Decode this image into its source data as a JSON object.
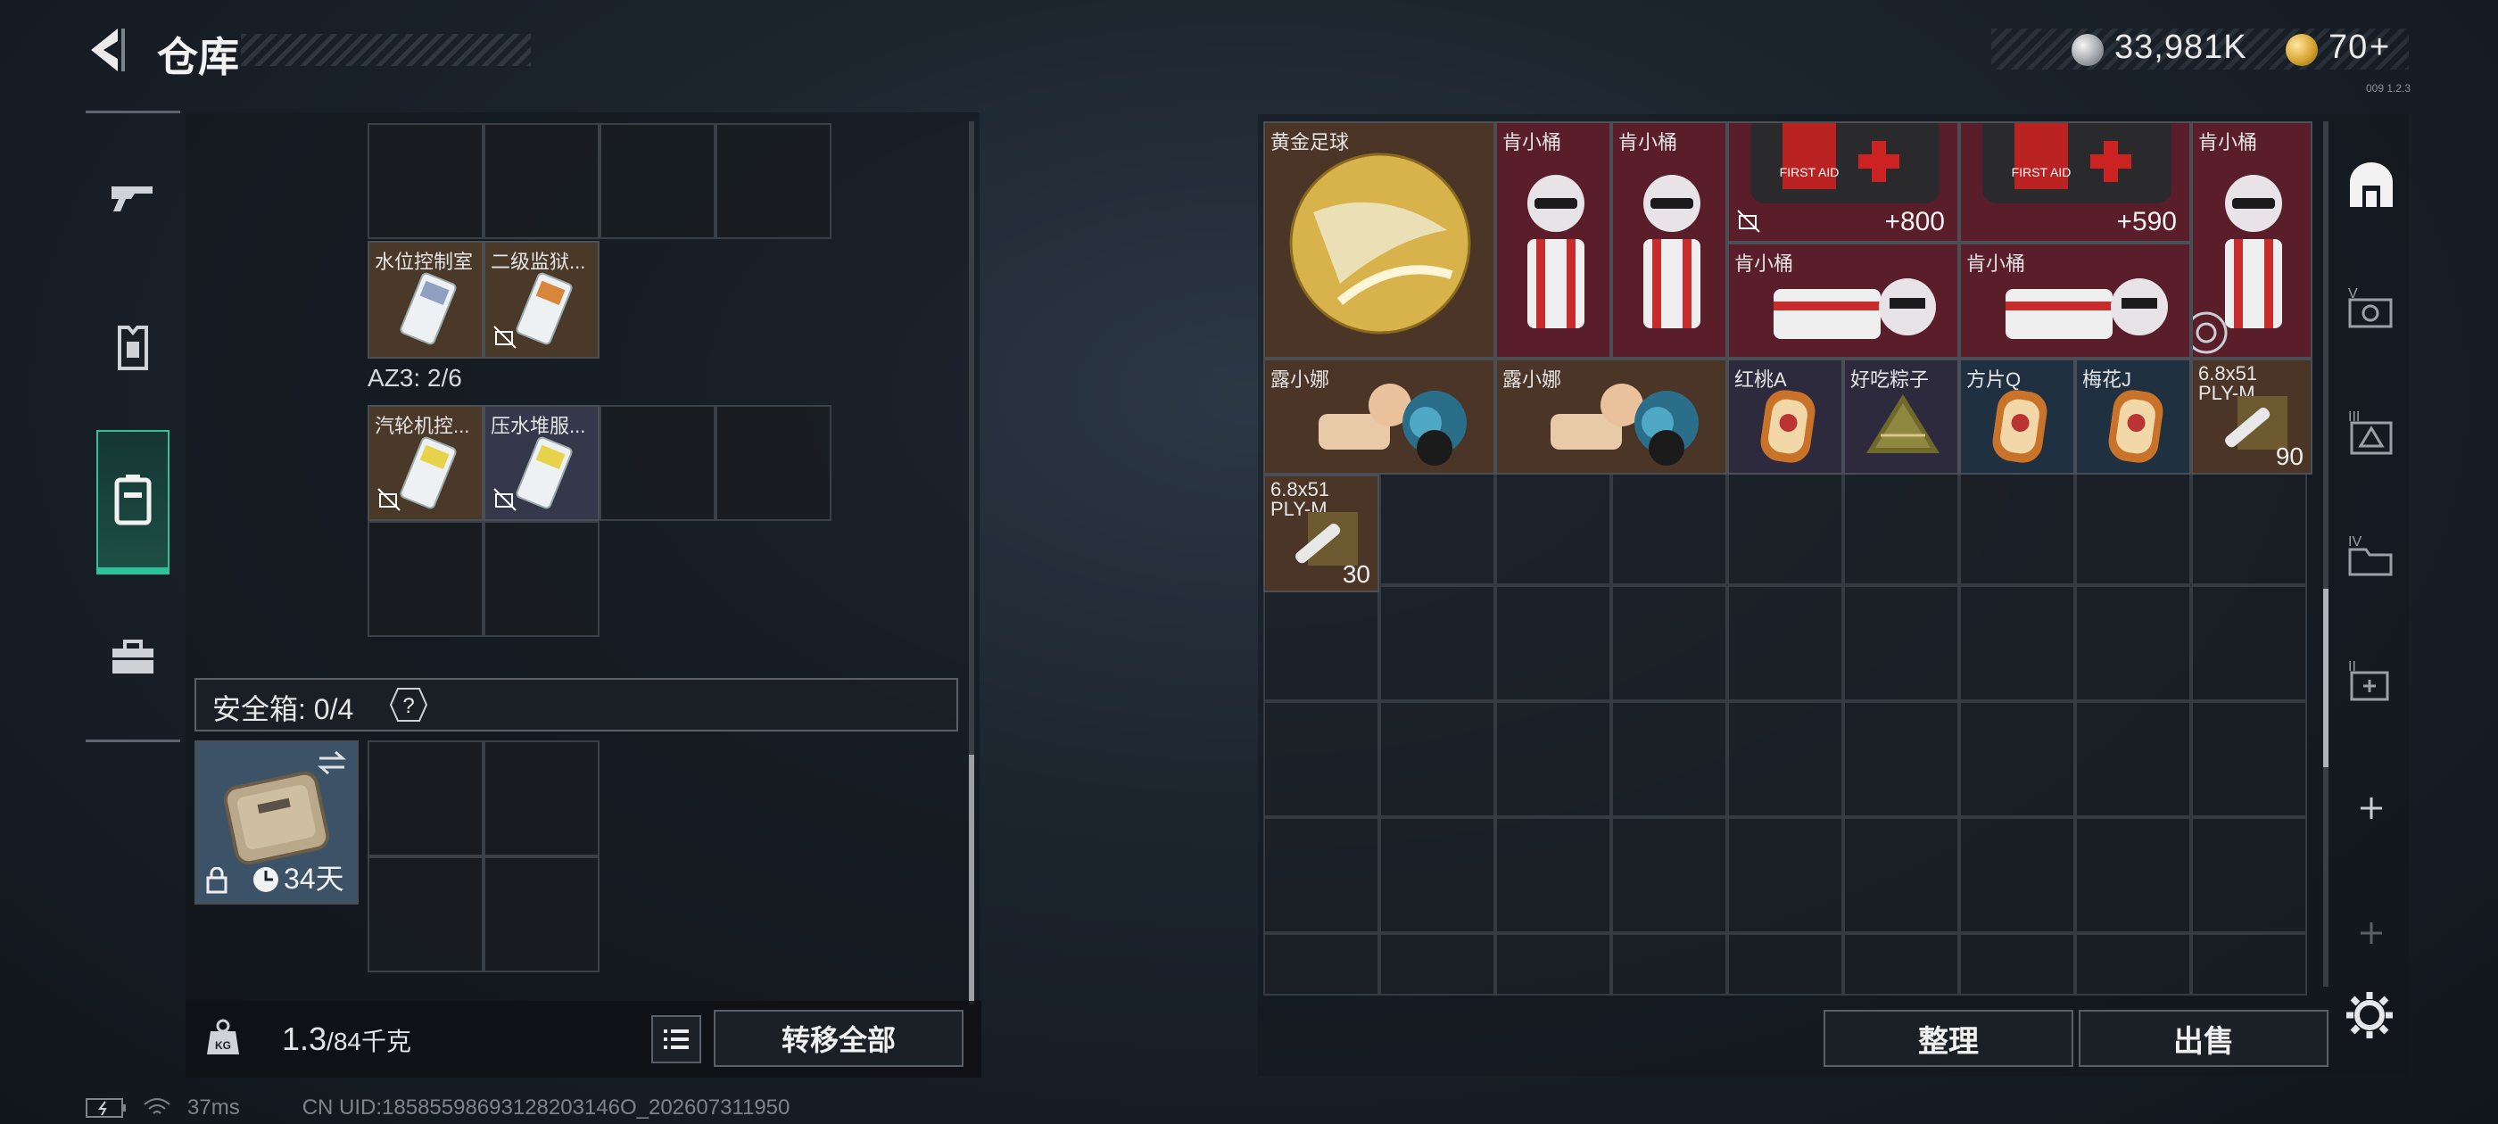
{
  "header": {
    "title": "仓库",
    "silver_value": "33,981K",
    "gold_value": "70",
    "gold_plus": "+",
    "version": "009 1.2.3"
  },
  "left_nav": {
    "items": [
      "weapon-icon",
      "armor-icon",
      "backpack-icon",
      "toolbox-icon"
    ],
    "active_index": 2
  },
  "left_panel": {
    "cards": [
      {
        "label": "水位控制室"
      },
      {
        "label": "二级监狱..."
      },
      {
        "label": "汽轮机控..."
      },
      {
        "label": "压水堆服..."
      }
    ],
    "az3_label": "AZ3: 2/6",
    "safebox_label": "安全箱: 0/4",
    "help": "?",
    "case_days": "34天"
  },
  "bottom_left": {
    "weight_current": "1.3",
    "weight_max": "/84千克",
    "transfer_all": "转移全部"
  },
  "right_panel": {
    "items": [
      {
        "label": "黄金足球"
      },
      {
        "label": "肯小桶"
      },
      {
        "label": "肯小桶"
      },
      {
        "label": "+800"
      },
      {
        "label": "+590"
      },
      {
        "label": "肯小桶"
      },
      {
        "label": "肯小桶"
      },
      {
        "label": "肯小桶"
      },
      {
        "label": "露小娜"
      },
      {
        "label": "露小娜"
      },
      {
        "label": "红桃A"
      },
      {
        "label": "好吃粽子"
      },
      {
        "label": "方片Q"
      },
      {
        "label": "梅花J"
      },
      {
        "label": "6.8x51",
        "sub": "PLY-M",
        "count": "90"
      },
      {
        "label": "6.8x51",
        "sub": "PLY-M",
        "count": "30"
      }
    ],
    "sort_button": "整理",
    "sell_button": "出售"
  },
  "status_bar": {
    "ping": "37ms",
    "uid": "CN UID:18585598693128203146O_202607311950"
  },
  "colors": {
    "accent_green": "#2fc29a",
    "medkit_red": "#7a1f28",
    "pink_rarity": "#5a1e2a",
    "brown_rarity": "#4a3526",
    "blue_rarity": "#1f3040"
  }
}
